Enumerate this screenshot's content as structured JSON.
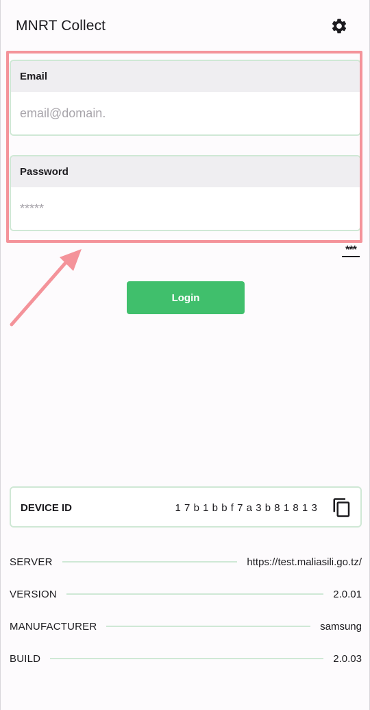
{
  "app": {
    "title": "MNRT Collect"
  },
  "icons": {
    "settings": "gear-icon",
    "copy": "copy-icon"
  },
  "form": {
    "email": {
      "label": "Email",
      "placeholder": "email@domain.",
      "value": ""
    },
    "password": {
      "label": "Password",
      "placeholder": "*****",
      "value": ""
    },
    "toggle_label": "***",
    "login_label": "Login"
  },
  "device": {
    "label": "DEVICE ID",
    "value": "17b1bbf7a3b81813"
  },
  "info": [
    {
      "key": "SERVER",
      "value": "https://test.maliasili.go.tz/"
    },
    {
      "key": "VERSION",
      "value": "2.0.01"
    },
    {
      "key": "MANUFACTURER",
      "value": "samsung"
    },
    {
      "key": "BUILD",
      "value": "2.0.03"
    }
  ],
  "colors": {
    "accent": "#40bf6c",
    "border": "#cfe8d5",
    "highlight": "#f4939a",
    "label_bg": "#efeef1"
  }
}
